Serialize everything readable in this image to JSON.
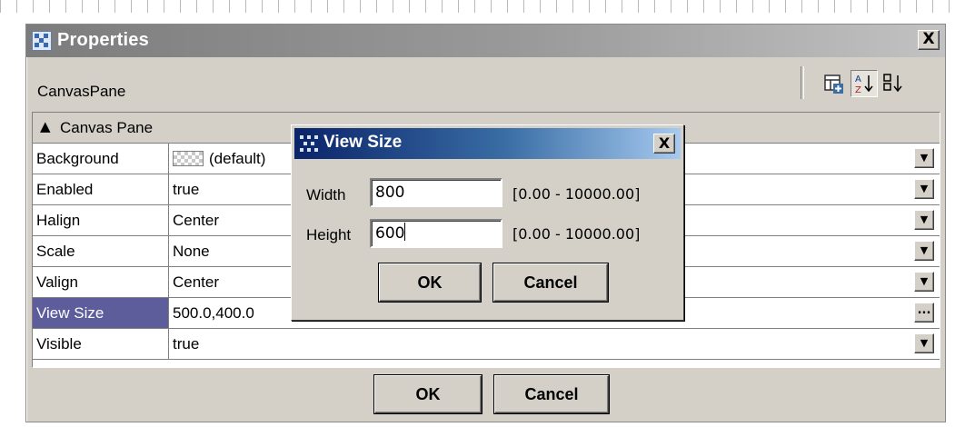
{
  "window": {
    "title": "Properties",
    "close_label": "X",
    "object_name": "CanvasPane"
  },
  "toolbar": {
    "icons": [
      "add-property-icon",
      "sort-alphabetical-icon",
      "sort-by-type-icon"
    ],
    "sort_az_label": "A↓Z",
    "sort_type_label": "8↓"
  },
  "group": {
    "arrow": "▲",
    "label": "Canvas Pane"
  },
  "properties": [
    {
      "name": "Background",
      "value": "(default)"
    },
    {
      "name": "Enabled",
      "value": "true"
    },
    {
      "name": "Halign",
      "value": "Center"
    },
    {
      "name": "Scale",
      "value": "None"
    },
    {
      "name": "Valign",
      "value": "Center"
    },
    {
      "name": "View Size",
      "value": "500.0,400.0"
    },
    {
      "name": "Visible",
      "value": "true"
    }
  ],
  "dropdown_glyph": "▼",
  "ellipsis_glyph": "...",
  "footer": {
    "ok_label": "OK",
    "cancel_label": "Cancel"
  },
  "dialog": {
    "title": "View Size",
    "close_label": "X",
    "width_label": "Width",
    "width_value": "800",
    "width_range": "[0.00 - 10000.00]",
    "height_label": "Height",
    "height_value": "600",
    "height_range": "[0.00 - 10000.00]",
    "ok_label": "OK",
    "cancel_label": "Cancel"
  },
  "colors": {
    "selected_row": "#5d5d9c",
    "dialog_title_start": "#0a246a",
    "dialog_title_end": "#a6caf0",
    "window_bg": "#d4d0c8"
  }
}
